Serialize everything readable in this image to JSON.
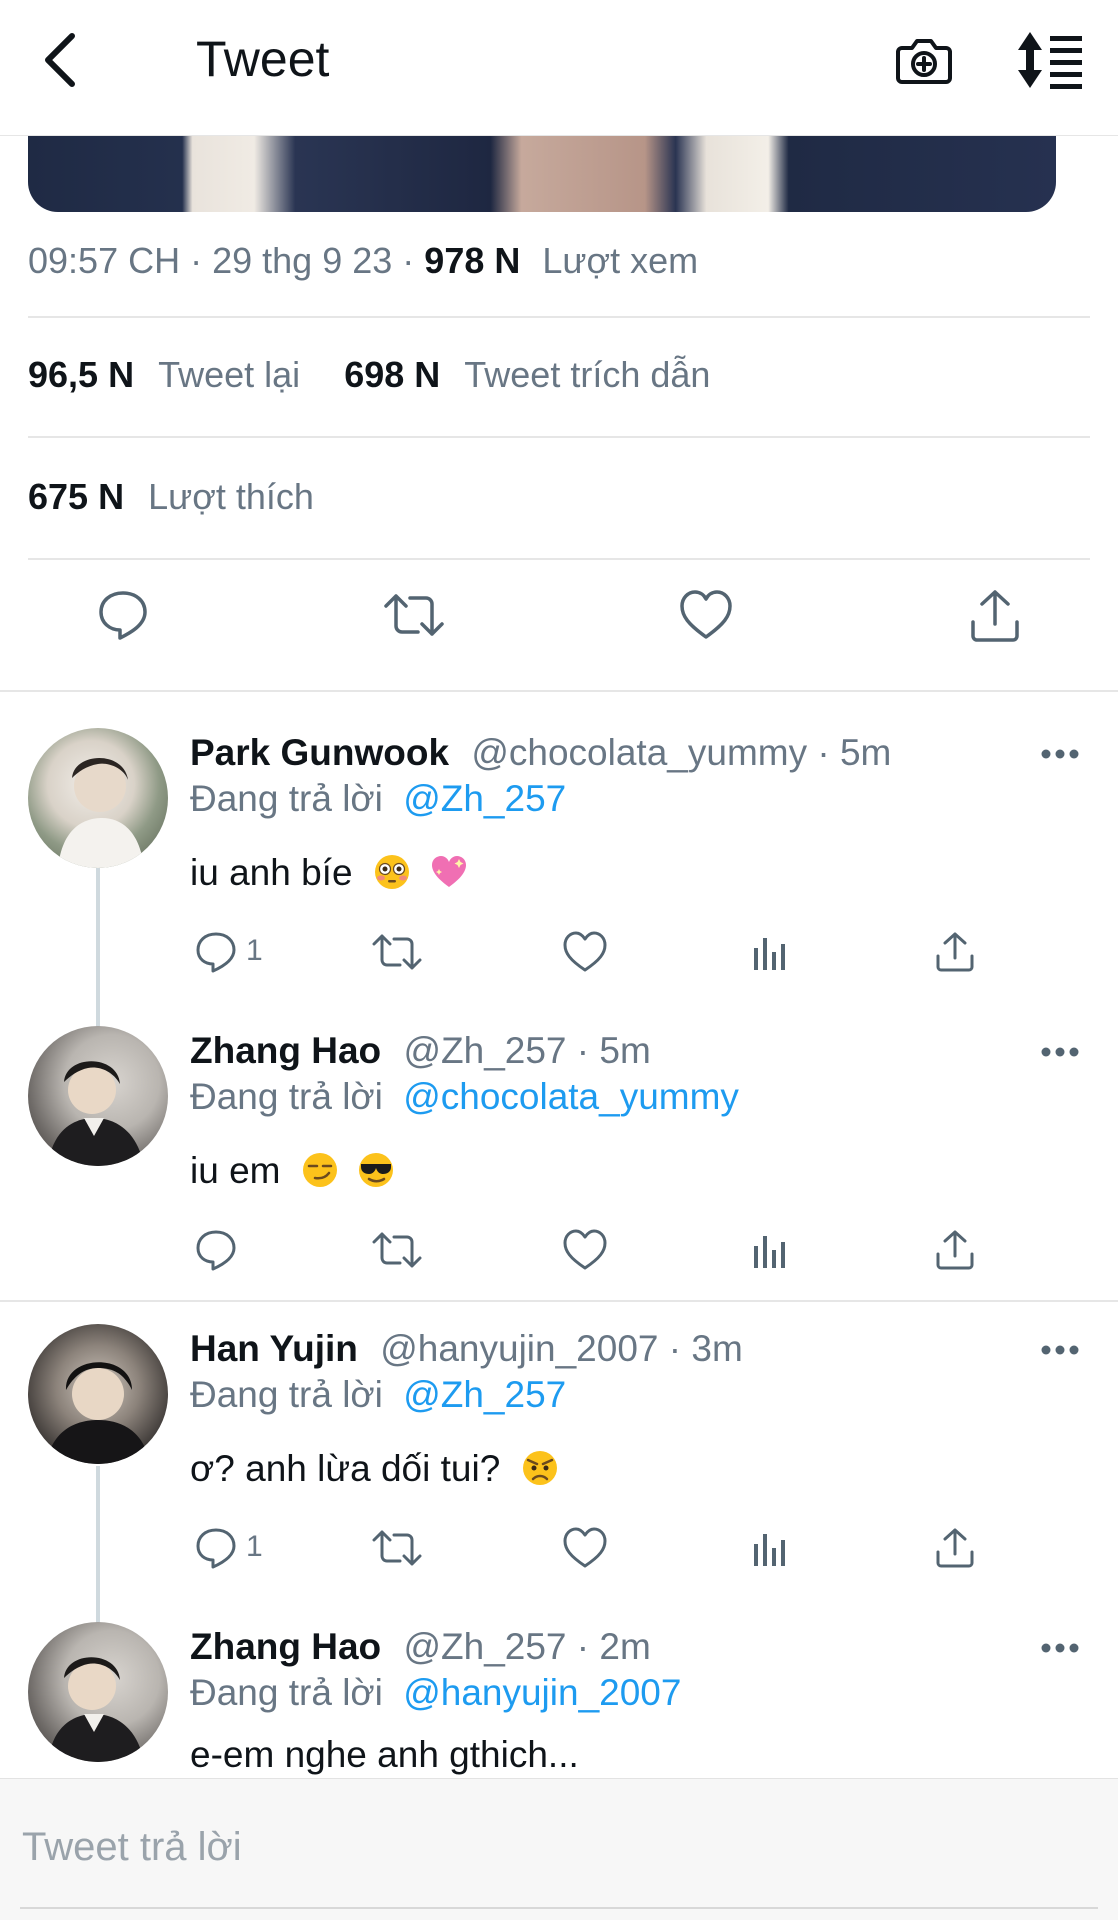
{
  "header": {
    "title": "Tweet",
    "back_icon": "chevron-left-icon",
    "camera_icon": "camera-plus-icon",
    "sort_icon": "sort-list-icon"
  },
  "tweet": {
    "time": "09:57 CH",
    "date": "29 thg 9 23",
    "views_count": "978 N",
    "views_label": "Lượt xem",
    "retweets_count": "96,5 N",
    "retweets_label": "Tweet lại",
    "quotes_count": "698 N",
    "quotes_label": "Tweet trích dẫn",
    "likes_count": "675 N",
    "likes_label": "Lượt thích"
  },
  "replies": [
    {
      "name": "Park Gunwook",
      "handle": "@chocolata_yummy",
      "time": "5m",
      "replying_prefix": "Đang trả lời",
      "replying_to": "@Zh_257",
      "text": "iu anh bíe",
      "emojis": [
        "flushed-face",
        "sparkling-heart"
      ],
      "reply_count": "1"
    },
    {
      "name": "Zhang Hao",
      "handle": "@Zh_257",
      "time": "5m",
      "replying_prefix": "Đang trả lời",
      "replying_to": "@chocolata_yummy",
      "text": "iu em",
      "emojis": [
        "smirking-face",
        "sunglasses-face"
      ],
      "reply_count": ""
    },
    {
      "name": "Han Yujin",
      "handle": "@hanyujin_2007",
      "time": "3m",
      "replying_prefix": "Đang trả lời",
      "replying_to": "@Zh_257",
      "text": "ơ? anh lừa dối tui?",
      "emojis": [
        "angry-face"
      ],
      "reply_count": "1"
    },
    {
      "name": "Zhang Hao",
      "handle": "@Zh_257",
      "time": "2m",
      "replying_prefix": "Đang trả lời",
      "replying_to": "@hanyujin_2007",
      "text": "e-em nghe anh gthich...",
      "emojis": [],
      "reply_count": ""
    }
  ],
  "composer": {
    "placeholder": "Tweet trả lời"
  },
  "colors": {
    "accent": "#1d9bf0",
    "text": "#0f1419",
    "muted": "#687684",
    "divider": "#e6e6e6"
  }
}
